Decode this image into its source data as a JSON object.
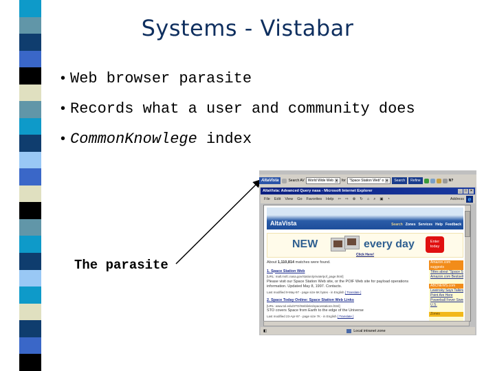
{
  "slide": {
    "title": "Systems - Vistabar",
    "bullets": [
      {
        "text": "Web browser parasite",
        "italic_prefix": ""
      },
      {
        "text": "Records what a user and community does",
        "italic_prefix": ""
      },
      {
        "italic_prefix": "CommonKnowlege",
        "text": " index"
      }
    ],
    "bullet_glyph": "•",
    "callout_label": "The parasite",
    "stripe_colors": [
      "#0e9ac9",
      "#6196a8",
      "#0f3d6e",
      "#3a67c8",
      "#000000",
      "#e0e0c0",
      "#6196a8",
      "#0e9ac9",
      "#0f3d6e",
      "#99c8f5",
      "#3a67c8",
      "#e0e0c0",
      "#000000",
      "#6196a8",
      "#0e9ac9",
      "#0f3d6e",
      "#99c8f5",
      "#0e9ac9",
      "#e0e0c0",
      "#0f3d6e",
      "#3a67c8",
      "#000000"
    ]
  },
  "screenshot": {
    "vistabar": {
      "logo": "AltaVista",
      "search_label": "Search AV",
      "scope_value": "World Wide Web",
      "for_label": "for",
      "query_value": "\"Space Station Web\" o",
      "search_button": "Search",
      "refine_button": "Refine"
    },
    "window_title": "AltaVista: Advanced Query nasa - Microsoft Internet Explorer",
    "menu": [
      "File",
      "Edit",
      "View",
      "Go",
      "Favorites",
      "Help"
    ],
    "address_label": "Address",
    "page": {
      "brand": "AltaVista",
      "nav": [
        "Search",
        "Zones",
        "Services",
        "Help",
        "Feedback"
      ],
      "banner": {
        "new": "NEW",
        "every_day": "every day",
        "badge": "Enter today",
        "cta": "Click Here!"
      },
      "match_count_prefix": "About ",
      "match_count": "1,110,814",
      "match_count_suffix": " matches were found.",
      "results": [
        {
          "title": "1. Space Station Web",
          "url": "[URL: mall.msfc.nasa.gov/station/private/pof_page.html]",
          "snippet": "Please visit our Space Station Web site, or the POIF Web site for payload operations information. Updated May 8, 1997. Contacts.",
          "meta": "Last modified 9-May-97 - page size 6K bytes - in English ",
          "translate": "[ Translate ]"
        },
        {
          "title": "2. Space Today Online: Space Station Web Links",
          "url": "[URL: www.tol.edu/STO/Weblinks/spacestations.html]",
          "snippet": "STO covers Space from Earth to the edge of the Universe",
          "meta": "Last modified 23-Apr-97 - page size 7K - in English ",
          "translate": "[ Translate ]"
        }
      ],
      "sidebar": {
        "amazon_header": "Amazon.com suggests",
        "amazon_items": [
          "Titles about \"Space Stati...",
          "Amazon.com Bestsellers"
        ],
        "abc_header": "ABCNEWS.com",
        "abc_items": [
          "Lewinsky Says Talking",
          "Point Are Here",
          "Powerball Fever Sweeps",
          "U.S."
        ],
        "zones_header": "Zones"
      }
    },
    "status": "Local intranet zone"
  }
}
